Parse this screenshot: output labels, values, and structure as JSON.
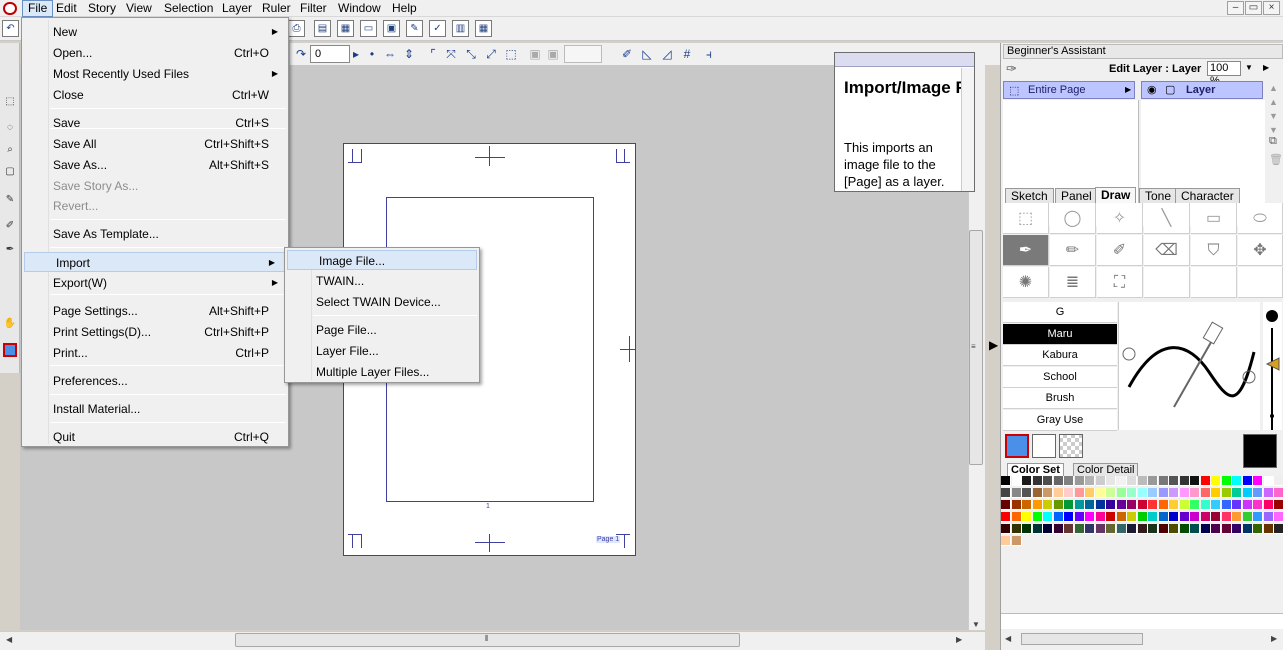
{
  "menubar": {
    "items": [
      "File",
      "Edit",
      "Story",
      "View",
      "Selection",
      "Layer",
      "Ruler",
      "Filter",
      "Window",
      "Help"
    ]
  },
  "window_controls": {
    "minimize": "–",
    "restore": "▭",
    "close": "×"
  },
  "toolbar": {
    "value_field": "0"
  },
  "file_menu": {
    "items": [
      {
        "label": "New",
        "shortcut": "",
        "arrow": true,
        "disabled": false
      },
      {
        "label": "Open...",
        "shortcut": "Ctrl+O",
        "arrow": false,
        "disabled": false
      },
      {
        "label": "Most Recently Used Files",
        "shortcut": "",
        "arrow": true,
        "disabled": false
      },
      {
        "label": "Close",
        "shortcut": "Ctrl+W",
        "arrow": false,
        "disabled": false
      },
      {
        "label": "Save",
        "shortcut": "Ctrl+S",
        "arrow": false,
        "disabled": false
      },
      {
        "label": "Save All",
        "shortcut": "Ctrl+Shift+S",
        "arrow": false,
        "disabled": false
      },
      {
        "label": "Save As...",
        "shortcut": "Alt+Shift+S",
        "arrow": false,
        "disabled": false
      },
      {
        "label": "Save Story As...",
        "shortcut": "",
        "arrow": false,
        "disabled": true
      },
      {
        "label": "Revert...",
        "shortcut": "",
        "arrow": false,
        "disabled": true
      },
      {
        "label": "Save As Template...",
        "shortcut": "",
        "arrow": false,
        "disabled": false
      },
      {
        "label": "Import",
        "shortcut": "",
        "arrow": true,
        "disabled": false,
        "highlighted": true
      },
      {
        "label": "Export(W)",
        "shortcut": "",
        "arrow": true,
        "disabled": false
      },
      {
        "label": "Page Settings...",
        "shortcut": "Alt+Shift+P",
        "arrow": false,
        "disabled": false
      },
      {
        "label": "Print Settings(D)...",
        "shortcut": "Ctrl+Shift+P",
        "arrow": false,
        "disabled": false
      },
      {
        "label": "Print...",
        "shortcut": "Ctrl+P",
        "arrow": false,
        "disabled": false
      },
      {
        "label": "Preferences...",
        "shortcut": "",
        "arrow": false,
        "disabled": false
      },
      {
        "label": "Install Material...",
        "shortcut": "",
        "arrow": false,
        "disabled": false
      },
      {
        "label": "Quit",
        "shortcut": "Ctrl+Q",
        "arrow": false,
        "disabled": false
      }
    ]
  },
  "import_submenu": {
    "items": [
      {
        "label": "Image File...",
        "highlighted": true
      },
      {
        "label": "TWAIN..."
      },
      {
        "label": "Select TWAIN Device..."
      },
      {
        "label": "Page File..."
      },
      {
        "label": "Layer File..."
      },
      {
        "label": "Multiple Layer Files..."
      }
    ]
  },
  "help_box": {
    "title": "Import/Image File...",
    "text": "This imports an image file to the [Page] as a layer."
  },
  "canvas": {
    "page_label": "Page 1",
    "center_mark": "1"
  },
  "right_panel": {
    "title": "Beginner's Assistant",
    "edit_layer_label": "Edit Layer : Layer",
    "zoom": "100 %",
    "entire_page": "Entire Page",
    "layer": "Layer",
    "tabs": [
      "Sketch",
      "Panel",
      "Draw",
      "Tone",
      "Character"
    ],
    "active_tab": "Draw",
    "brushes": [
      "G",
      "Maru",
      "Kabura",
      "School",
      "Brush",
      "Gray Use"
    ],
    "selected_brush": "Maru",
    "color_tabs": [
      "Color Set",
      "Color Detail"
    ],
    "colors": {
      "main": "#4a8fe8",
      "sub": "#ffffff",
      "current": "#000000"
    }
  }
}
